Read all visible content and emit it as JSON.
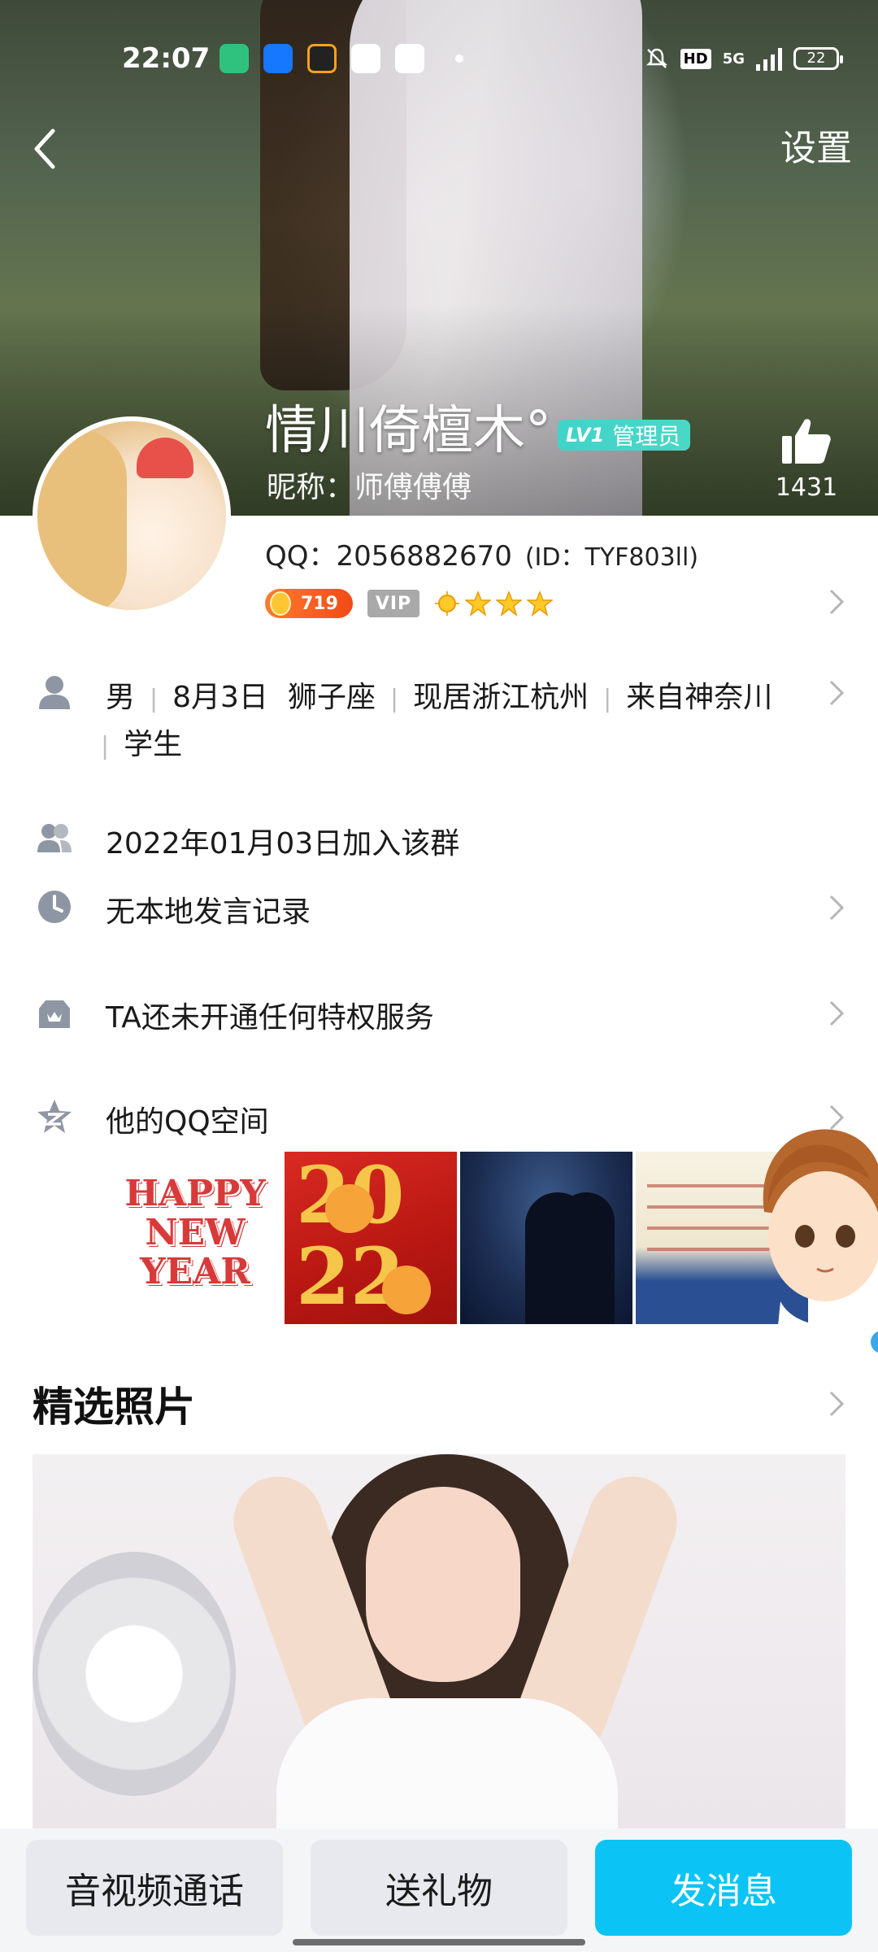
{
  "status_bar": {
    "time": "22:07",
    "network_badge": "HD",
    "network_type": "5G",
    "battery": "22"
  },
  "nav": {
    "settings_label": "设置"
  },
  "profile": {
    "nickname": "情川倚檀木°",
    "level_badge": "LV1",
    "role_badge": "管理员",
    "alias": "昵称：师傅傅傅",
    "likes": "1431",
    "qq_label": "QQ：2056882670",
    "id_label": "(ID：TYF803ll)",
    "coin_count": "719",
    "vip_label": "VIP"
  },
  "details": {
    "gender": "男",
    "birthday": "8月3日",
    "zodiac": "狮子座",
    "location": "现居浙江杭州",
    "hometown": "来自神奈川",
    "occupation": "学生",
    "join_date": "2022年01月03日加入该群",
    "chat_record": "无本地发言记录",
    "privilege": "TA还未开通任何特权服务",
    "qzone": "他的QQ空间"
  },
  "thumbnails": {
    "t1_text": "HAPPY NEW YEAR",
    "t2_text": "20 22"
  },
  "featured": {
    "title": "精选照片"
  },
  "actions": {
    "call": "音视频通话",
    "gift": "送礼物",
    "message": "发消息"
  },
  "colors": {
    "accent": "#0bc4f5",
    "level_badge": "#3fd4c9",
    "coin_badge": "#f24a17"
  }
}
